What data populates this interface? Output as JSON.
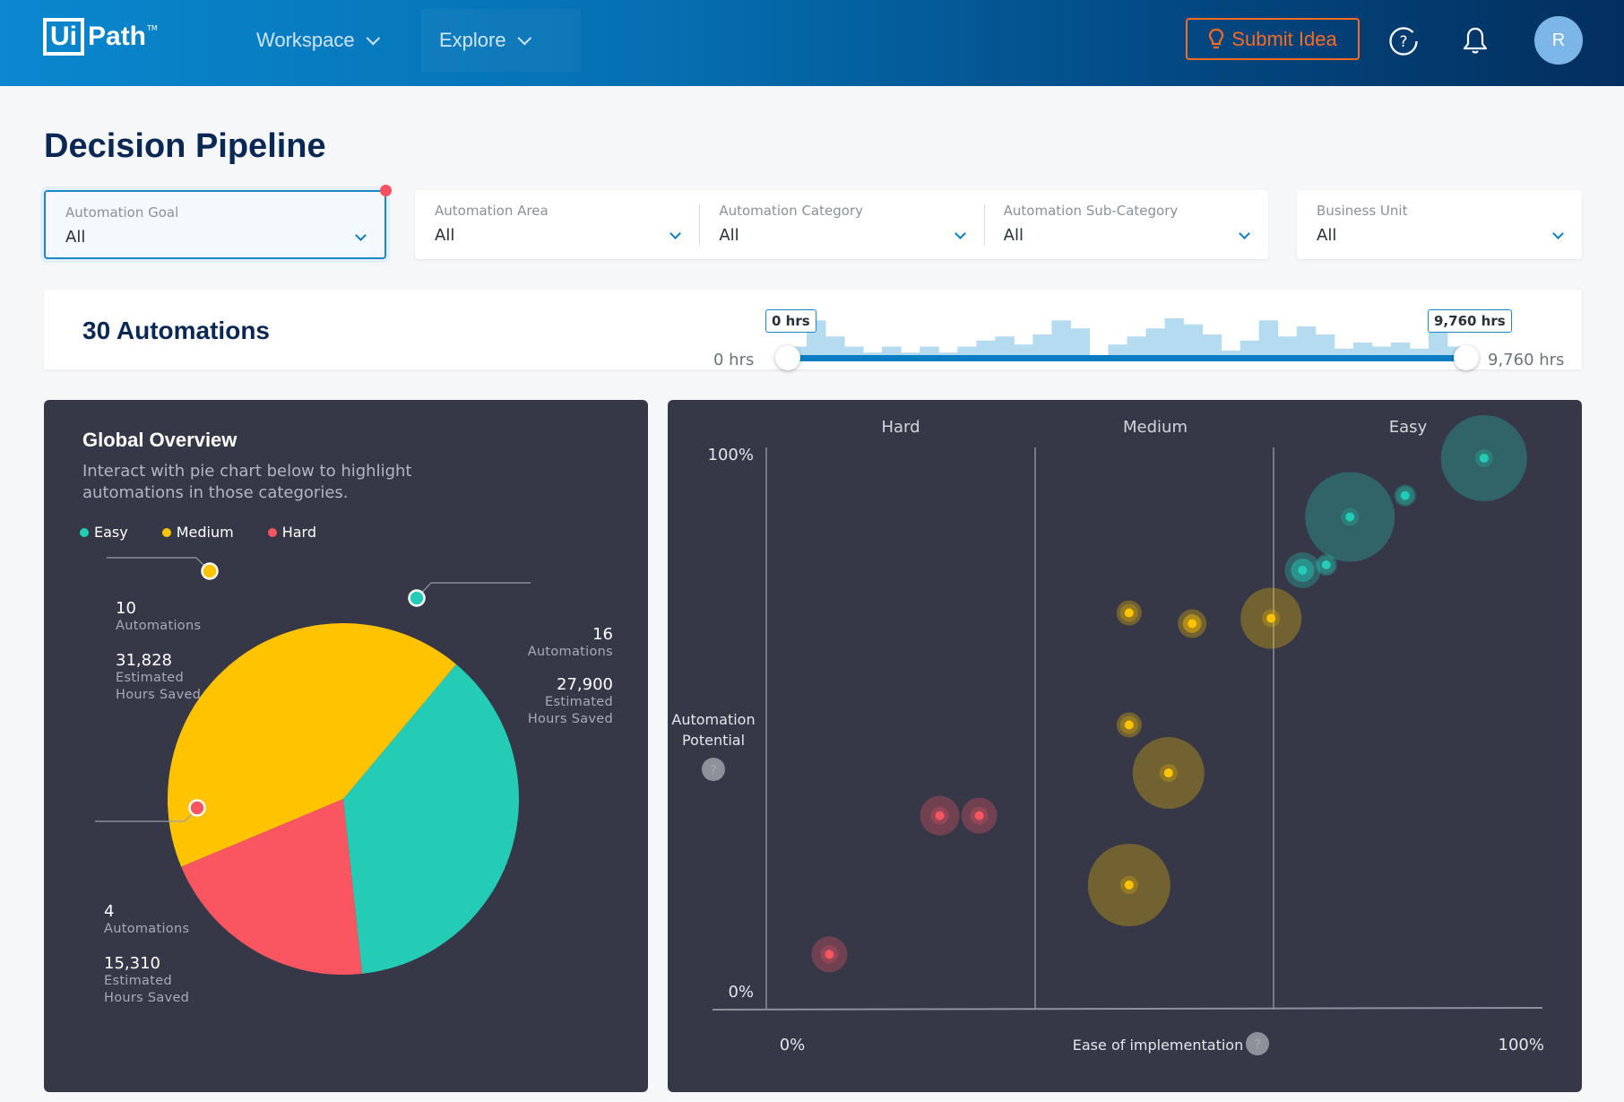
{
  "header": {
    "logo_box": "Ui",
    "logo_text": "Path",
    "logo_tm": "TM",
    "nav": [
      {
        "label": "Workspace"
      },
      {
        "label": "Explore"
      }
    ],
    "submit_idea_label": "Submit Idea",
    "avatar_initial": "R",
    "icons": {
      "submit": "lightbulb-icon",
      "help": "help-circle-icon",
      "notifications": "bell-icon"
    }
  },
  "page": {
    "title": "Decision Pipeline"
  },
  "filters": [
    {
      "label": "Automation Goal",
      "value": "All",
      "active": true
    },
    {
      "label": "Automation Area",
      "value": "All"
    },
    {
      "label": "Automation Category",
      "value": "All"
    },
    {
      "label": "Automation Sub-Category",
      "value": "All"
    },
    {
      "label": "Business Unit",
      "value": "All"
    }
  ],
  "summary": {
    "count_label": "30 Automations",
    "range": {
      "min_label": "0 hrs",
      "max_label": "9,760 hrs",
      "selected_min_label": "0 hrs",
      "selected_max_label": "9,760 hrs",
      "min": 0,
      "max": 9760,
      "selected_min": 0,
      "selected_max": 9760
    },
    "histogram_relative": [
      0.3,
      0.95,
      0.55,
      0.3,
      0.15,
      0.3,
      0.15,
      0.3,
      0.15,
      0.3,
      0.45,
      0.55,
      0.35,
      0.6,
      0.95,
      0.75,
      0.05,
      0.35,
      0.55,
      0.75,
      1.0,
      0.85,
      0.6,
      0.2,
      0.45,
      0.95,
      0.55,
      0.8,
      0.6,
      0.25,
      0.4,
      0.3,
      0.4,
      0.25,
      0.65,
      0.3
    ]
  },
  "overview": {
    "title": "Global Overview",
    "description": "Interact with pie chart below to highlight automations in those categories.",
    "legend": [
      {
        "label": "Easy",
        "color": "#24cbb5"
      },
      {
        "label": "Medium",
        "color": "#ffc300"
      },
      {
        "label": "Hard",
        "color": "#fa5662"
      }
    ],
    "callouts": {
      "medium": {
        "count": "10",
        "count_label": "Automations",
        "hours": "31,828",
        "hours_label_1": "Estimated",
        "hours_label_2": "Hours Saved"
      },
      "easy": {
        "count": "16",
        "count_label": "Automations",
        "hours": "27,900",
        "hours_label_1": "Estimated",
        "hours_label_2": "Hours Saved"
      },
      "hard": {
        "count": "4",
        "count_label": "Automations",
        "hours": "15,310",
        "hours_label_1": "Estimated",
        "hours_label_2": "Hours Saved"
      }
    }
  },
  "chart_data": [
    {
      "type": "pie",
      "title": "Global Overview",
      "categories": [
        "Easy",
        "Medium",
        "Hard"
      ],
      "values": [
        27900,
        31828,
        15310
      ],
      "automations": [
        16,
        10,
        4
      ],
      "colors": [
        "#24cbb5",
        "#ffc300",
        "#fa5662"
      ],
      "value_label": "Estimated Hours Saved",
      "legend_position": "top-left"
    },
    {
      "type": "scatter",
      "subtype": "bubble",
      "xlabel": "Ease of implementation",
      "ylabel": "Automation Potential",
      "xlim": [
        0,
        100
      ],
      "ylim": [
        0,
        100
      ],
      "x_tick_labels": [
        "0%",
        "100%"
      ],
      "y_tick_labels": [
        "100%",
        "0%"
      ],
      "zones": [
        {
          "label": "Hard",
          "from": 0,
          "to": 35
        },
        {
          "label": "Medium",
          "from": 35,
          "to": 66
        },
        {
          "label": "Easy",
          "from": 66,
          "to": 100
        }
      ],
      "series": [
        {
          "name": "Easy",
          "color": "#24cbb5",
          "points": [
            {
              "x": 91,
              "y": 100,
              "size": 48
            },
            {
              "x": 74,
              "y": 89,
              "size": 50
            },
            {
              "x": 81,
              "y": 93,
              "size": 12
            },
            {
              "x": 71,
              "y": 80,
              "size": 12
            },
            {
              "x": 68,
              "y": 79,
              "size": 20,
              "highlighted": true
            }
          ]
        },
        {
          "name": "Medium",
          "color": "#ffc300",
          "points": [
            {
              "x": 46,
              "y": 71,
              "size": 14
            },
            {
              "x": 54,
              "y": 69,
              "size": 16,
              "highlighted": true
            },
            {
              "x": 64,
              "y": 70,
              "size": 34
            },
            {
              "x": 46,
              "y": 50,
              "size": 14
            },
            {
              "x": 51,
              "y": 41,
              "size": 40
            },
            {
              "x": 46,
              "y": 20,
              "size": 46
            }
          ]
        },
        {
          "name": "Hard",
          "color": "#fa5662",
          "points": [
            {
              "x": 22,
              "y": 33,
              "size": 22
            },
            {
              "x": 27,
              "y": 33,
              "size": 20
            },
            {
              "x": 8,
              "y": 7,
              "size": 20
            }
          ]
        }
      ]
    }
  ],
  "bubble": {
    "ylabel_1": "Automation",
    "ylabel_2": "Potential",
    "xlabel": "Ease of implementation",
    "help_glyph": "?"
  }
}
